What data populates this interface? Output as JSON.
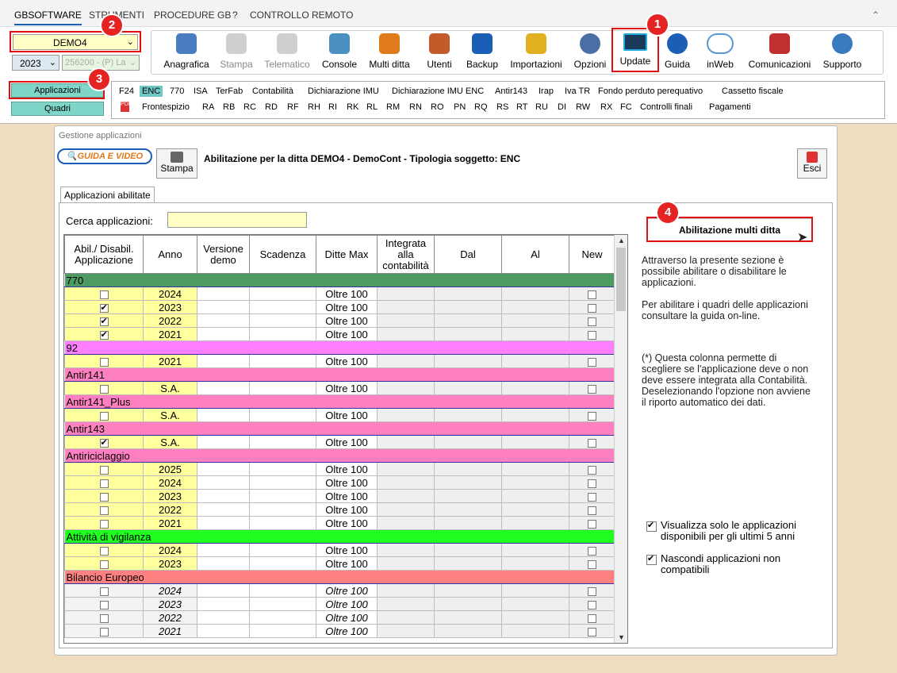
{
  "menu": [
    "GBSOFTWARE",
    "STRUMENTI",
    "PROCEDURE GB",
    "?",
    "CONTROLLO REMOTO"
  ],
  "company_select": "DEMO4",
  "year_select": "2023",
  "client_select": "256200 - (P) La",
  "toolbar": [
    {
      "label": "Anagrafica",
      "icon": "person-card-icon",
      "color": "#4a7cc2"
    },
    {
      "label": "Stampa",
      "icon": "printer-icon",
      "color": "#888"
    },
    {
      "label": "Telematico",
      "icon": "document-icon",
      "color": "#888"
    },
    {
      "label": "Console",
      "icon": "monitor-icon",
      "color": "#4a90c0"
    },
    {
      "label": "Multi ditta",
      "icon": "org-chart-icon",
      "color": "#e07a1a"
    },
    {
      "label": "Utenti",
      "icon": "users-icon",
      "color": "#c25a2a"
    },
    {
      "label": "Backup",
      "icon": "floppy-icon",
      "color": "#1a5fb4"
    },
    {
      "label": "Importazioni",
      "icon": "import-icon",
      "color": "#e0b020"
    },
    {
      "label": "Opzioni",
      "icon": "gear-icon",
      "color": "#4a6fa5"
    },
    {
      "label": "Update",
      "icon": "monitor-pulse-icon",
      "color": "#1a3a5a"
    },
    {
      "label": "Guida",
      "icon": "help-icon",
      "color": "#1a5fb4"
    },
    {
      "label": "inWeb",
      "icon": "cloud-icon",
      "color": "#5a9ad5"
    },
    {
      "label": "Comunicazioni",
      "icon": "megaphone-icon",
      "color": "#c03030"
    },
    {
      "label": "Supporto",
      "icon": "support-icon",
      "color": "#3a7ac0"
    }
  ],
  "side": {
    "applicazioni": "Applicazioni",
    "quadri": "Quadri"
  },
  "quick_row1": [
    "F24",
    "ENC",
    "770",
    "ISA",
    "TerFab",
    "Contabilità",
    "Dichiarazione IMU",
    "Dichiarazione IMU ENC",
    "Antir143",
    "Irap",
    "Iva TR",
    "Fondo perduto perequativo",
    "Cassetto fiscale"
  ],
  "quick_row2": [
    "Frontespizio",
    "RA",
    "RB",
    "RC",
    "RD",
    "RF",
    "RH",
    "RI",
    "RK",
    "RL",
    "RM",
    "RN",
    "RO",
    "PN",
    "RQ",
    "RS",
    "RT",
    "RU",
    "DI",
    "RW",
    "RX",
    "FC",
    "Controlli finali",
    "Pagamenti"
  ],
  "badges": [
    "1",
    "2",
    "3",
    "4"
  ],
  "panel": {
    "title": "Gestione applicazioni",
    "guida": "GUIDA E VIDEO",
    "stampa": "Stampa",
    "header": "Abilitazione per la ditta DEMO4 -  DemoCont - Tipologia soggetto: ENC",
    "esci": "Esci",
    "tab": "Applicazioni abilitate",
    "search_label": "Cerca applicazioni:",
    "search_value": "",
    "multi_button": "Abilitazione multi ditta",
    "info1": "Attraverso la presente sezione è possibile abilitare o disabilitare le applicazioni.",
    "info2": "Per abilitare i quadri delle applicazioni consultare la guida on-line.",
    "info3": "(*) Questa colonna permette di scegliere se l'applicazione deve o non deve essere integrata alla Contabilità. Deselezionando l'opzione non avviene il riporto automatico dei dati.",
    "opt1": "Visualizza solo le applicazioni disponibili per gli ultimi 5 anni",
    "opt2": "Nascondi applicazioni non compatibili"
  },
  "columns": [
    "Abil./ Disabil. Applicazione",
    "Anno",
    "Versione demo",
    "Scadenza",
    "Ditte Max",
    "Integrata alla contabilità",
    "Dal",
    "Al",
    "New"
  ],
  "groups": [
    {
      "name": "770",
      "color": "#4e9a63",
      "rows": [
        {
          "year": "2024",
          "on": false,
          "max": "Oltre 100"
        },
        {
          "year": "2023",
          "on": true,
          "max": "Oltre 100"
        },
        {
          "year": "2022",
          "on": true,
          "max": "Oltre 100"
        },
        {
          "year": "2021",
          "on": true,
          "max": "Oltre 100"
        }
      ]
    },
    {
      "name": "92",
      "color": "#ff80ff",
      "rows": [
        {
          "year": "2021",
          "on": false,
          "max": "Oltre 100"
        }
      ]
    },
    {
      "name": "Antir141",
      "color": "#ff80c0",
      "rows": [
        {
          "year": "S.A.",
          "on": false,
          "max": "Oltre 100"
        }
      ]
    },
    {
      "name": "Antir141_Plus",
      "color": "#ff80c0",
      "rows": [
        {
          "year": "S.A.",
          "on": false,
          "max": "Oltre 100"
        }
      ]
    },
    {
      "name": "Antir143",
      "color": "#ff80c0",
      "rows": [
        {
          "year": "S.A.",
          "on": true,
          "max": "Oltre 100"
        }
      ]
    },
    {
      "name": "Antiriciclaggio",
      "color": "#ff80c0",
      "rows": [
        {
          "year": "2025",
          "on": false,
          "max": "Oltre 100"
        },
        {
          "year": "2024",
          "on": false,
          "max": "Oltre 100"
        },
        {
          "year": "2023",
          "on": false,
          "max": "Oltre 100"
        },
        {
          "year": "2022",
          "on": false,
          "max": "Oltre 100"
        },
        {
          "year": "2021",
          "on": false,
          "max": "Oltre 100"
        }
      ]
    },
    {
      "name": "Attività di vigilanza",
      "color": "#20ff20",
      "rows": [
        {
          "year": "2024",
          "on": false,
          "max": "Oltre 100"
        },
        {
          "year": "2023",
          "on": false,
          "max": "Oltre 100"
        }
      ]
    },
    {
      "name": "Bilancio Europeo",
      "color": "#ff8080",
      "rows": [
        {
          "year": "2024",
          "on": false,
          "max": "Oltre 100",
          "dim": true
        },
        {
          "year": "2023",
          "on": false,
          "max": "Oltre 100",
          "dim": true
        },
        {
          "year": "2022",
          "on": false,
          "max": "Oltre 100",
          "dim": true
        },
        {
          "year": "2021",
          "on": false,
          "max": "Oltre 100",
          "dim": true
        }
      ]
    }
  ]
}
